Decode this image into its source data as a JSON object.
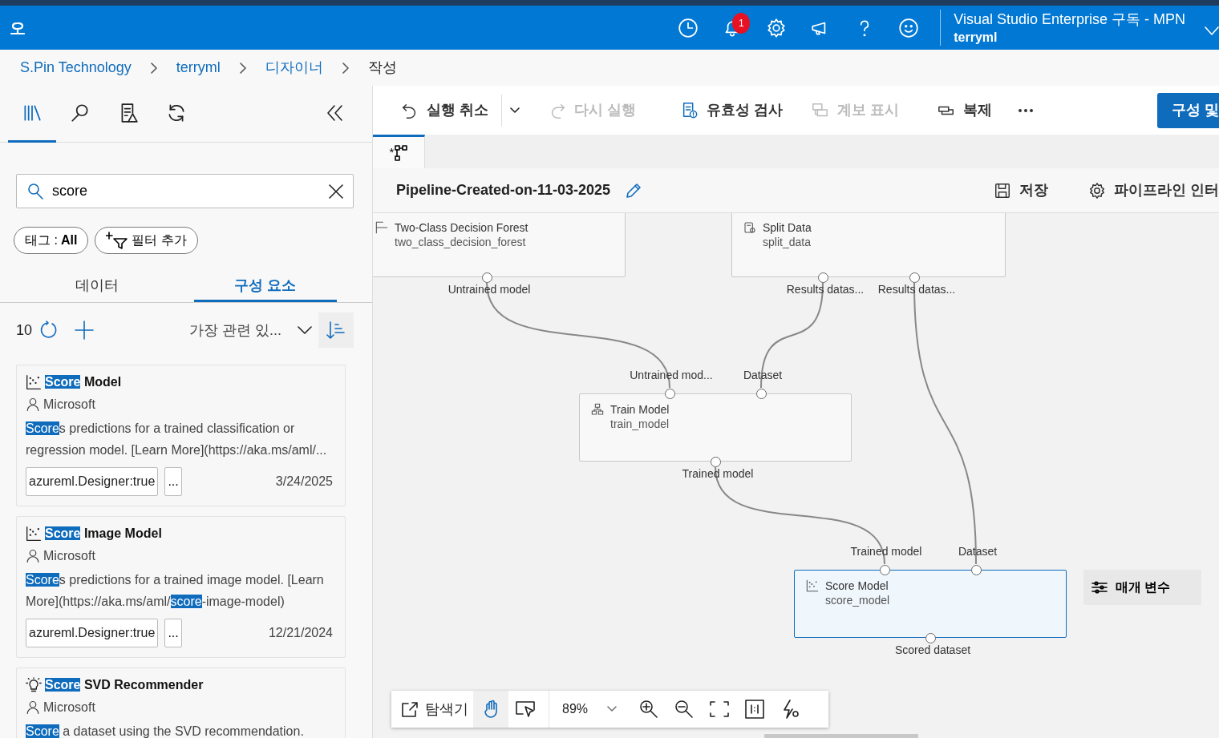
{
  "header": {
    "app_title": "오",
    "notification_count": "1",
    "subscription": "Visual Studio Enterprise 구독 - MPN",
    "user": "terryml"
  },
  "breadcrumb": [
    {
      "label": "S.Pin Technology",
      "current": false
    },
    {
      "label": "terryml",
      "current": false
    },
    {
      "label": "디자이너",
      "current": false
    },
    {
      "label": "작성",
      "current": true
    }
  ],
  "left_panel": {
    "icon_tabs": [
      {
        "kind": "library",
        "selected": true
      },
      {
        "kind": "search",
        "selected": false
      },
      {
        "kind": "report",
        "selected": false
      },
      {
        "kind": "refresh",
        "selected": false
      }
    ],
    "search": {
      "value": "score"
    },
    "filters": [
      {
        "kind": "tag",
        "label": "태그 : ",
        "value": "All"
      },
      {
        "kind": "add",
        "label": "필터 추가"
      }
    ],
    "tabs": [
      {
        "label": "데이터",
        "selected": false
      },
      {
        "label": "구성 요소",
        "selected": true
      }
    ],
    "result_count": "10",
    "sort": {
      "value": "가장 관련 있..."
    },
    "components": [
      {
        "kind": "chart",
        "title": "**Score** Model",
        "author": "Microsoft",
        "description": "**Score**s predictions for a trained classification or regression model. [Learn More](https://aka.ms/aml/...",
        "tag": "azureml.Designer:true",
        "more": "...",
        "date": "3/24/2025"
      },
      {
        "kind": "chart",
        "title": "**Score** Image Model",
        "author": "Microsoft",
        "description": "**Score**s predictions for a trained image model. [Learn More](https://aka.ms/aml/**score**-image-model)",
        "tag": "azureml.Designer:true",
        "more": "...",
        "date": "12/21/2024"
      },
      {
        "kind": "bulb",
        "title": "**Score** SVD Recommender",
        "author": "Microsoft",
        "description": "**Score** a dataset using the SVD recommendation."
      }
    ]
  },
  "toolbar": {
    "items": [
      {
        "kind": "undo",
        "label": "실행 취소",
        "disabled": false
      },
      {
        "kind": "redo",
        "label": "다시 실행",
        "disabled": true
      },
      {
        "kind": "validate",
        "label": "유효성 검사",
        "disabled": false
      },
      {
        "kind": "lineage",
        "label": "계보 표시",
        "disabled": true
      },
      {
        "kind": "clone",
        "label": "복제",
        "disabled": false
      }
    ],
    "primary_button": "구성 및"
  },
  "doc_tab": {
    "label": "*",
    "selected": true
  },
  "pipeline": {
    "name": "Pipeline-Created-on-11-03-2025",
    "actions": [
      {
        "kind": "save",
        "label": "저장"
      },
      {
        "kind": "settings",
        "label": "파이프라인 인터"
      }
    ]
  },
  "canvas": {
    "nodes": [
      {
        "kind": "model",
        "title": "Two-Class Decision Forest",
        "subtitle": "two_class_decision_forest",
        "selected": false,
        "outputs": [
          "Untrained model"
        ]
      },
      {
        "kind": "data",
        "title": "Split Data",
        "subtitle": "split_data",
        "selected": false,
        "outputs": [
          "Results datas...",
          "Results datas..."
        ]
      },
      {
        "kind": "train",
        "title": "Train Model",
        "subtitle": "train_model",
        "selected": false,
        "inputs": [
          "Untrained mod...",
          "Dataset"
        ],
        "outputs": [
          "Trained model"
        ]
      },
      {
        "kind": "chart",
        "title": "Score Model",
        "subtitle": "score_model",
        "selected": true,
        "inputs": [
          "Trained model",
          "Dataset"
        ],
        "outputs": [
          "Scored dataset"
        ]
      }
    ],
    "parameters_button": "매개 변수"
  },
  "zoom_toolbar": {
    "explorer": "탐색기",
    "modes": [
      {
        "kind": "pan",
        "selected": true
      },
      {
        "kind": "select",
        "selected": false
      }
    ],
    "zoom": "89%"
  }
}
